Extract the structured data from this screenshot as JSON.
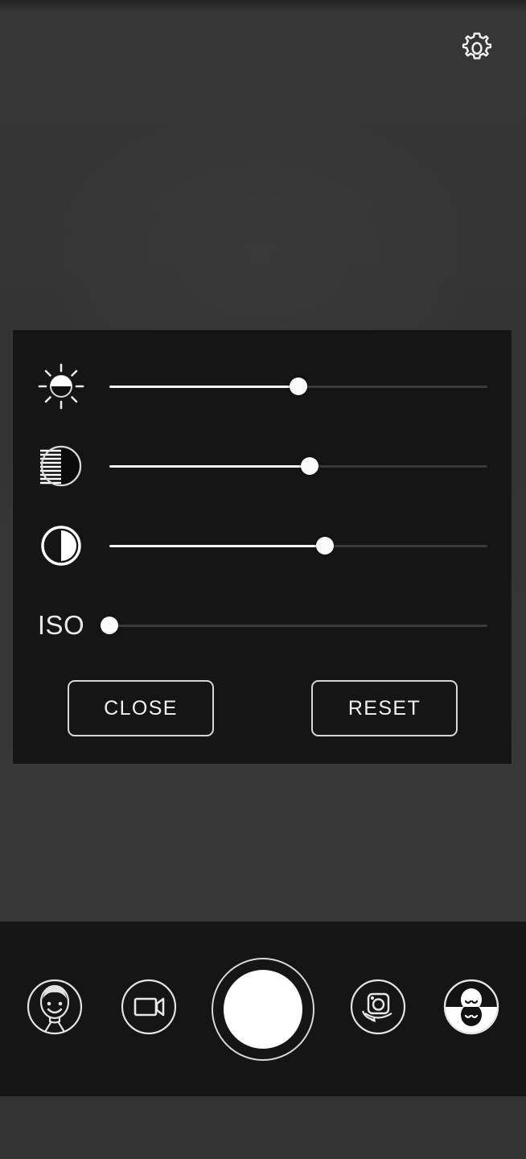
{
  "app": {
    "name": "Camera",
    "background_color": "#363636",
    "panel_color": "#151515",
    "accent_color": "#ffffff"
  },
  "header": {
    "settings_icon": "gear-icon",
    "settings_label": "Settings"
  },
  "panel": {
    "title": "",
    "sliders": [
      {
        "id": "brightness",
        "icon": "brightness-icon",
        "label": "Brightness",
        "value_percent": 50,
        "min": 0,
        "max": 100
      },
      {
        "id": "exposure",
        "icon": "exposure-icon",
        "label": "Exposure",
        "value_percent": 53,
        "min": 0,
        "max": 100
      },
      {
        "id": "contrast",
        "icon": "contrast-icon",
        "label": "Contrast",
        "value_percent": 57,
        "min": 0,
        "max": 100
      },
      {
        "id": "iso",
        "icon": "iso-text-label",
        "label": "ISO",
        "value_percent": 0,
        "min": 0,
        "max": 100
      }
    ],
    "buttons": {
      "close_label": "CLOSE",
      "reset_label": "RESET"
    }
  },
  "bottom_bar": {
    "items": [
      {
        "id": "beauty",
        "icon": "face-beauty-icon",
        "label": "Beauty mode"
      },
      {
        "id": "video",
        "icon": "video-camera-icon",
        "label": "Video mode"
      },
      {
        "id": "shutter",
        "icon": "shutter-button-icon",
        "label": "Capture"
      },
      {
        "id": "switch",
        "icon": "switch-camera-icon",
        "label": "Switch camera"
      },
      {
        "id": "filters",
        "icon": "filters-icon",
        "label": "Filters"
      }
    ]
  }
}
